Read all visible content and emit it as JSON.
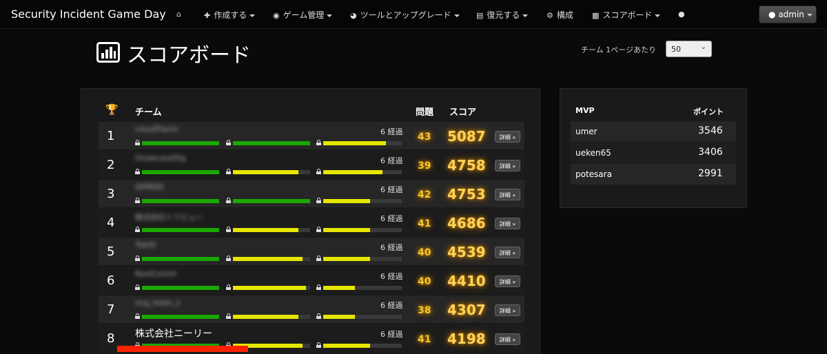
{
  "navbar": {
    "brand": "Security Incident Game Day",
    "items": [
      {
        "icon": "home-icon",
        "label": ""
      },
      {
        "icon": "plus-icon",
        "label": "作成する"
      },
      {
        "icon": "eye-icon",
        "label": "ゲーム管理"
      },
      {
        "icon": "dashboard-icon",
        "label": "ツールとアップグレード"
      },
      {
        "icon": "save-icon",
        "label": "復元する"
      },
      {
        "icon": "gear-icon",
        "label": "構成"
      },
      {
        "icon": "bar-chart-icon",
        "label": "スコアボード"
      },
      {
        "icon": "comment-icon",
        "label": ""
      }
    ],
    "user": "admin"
  },
  "page": {
    "title": "スコアボード",
    "per_page_label": "チーム 1ページあたり",
    "per_page_value": "50"
  },
  "scoreboard": {
    "headers": {
      "team": "チーム",
      "solved": "問題",
      "score": "スコア"
    },
    "rows": [
      {
        "rank": "1",
        "team": "cloudTrackr",
        "elapsed": "6 経過",
        "solved": "43",
        "score": "5087",
        "detail": "詳細 »",
        "bars": [
          {
            "color": "green",
            "fraction": 1.0
          },
          {
            "color": "green",
            "fraction": 1.0
          },
          {
            "color": "yellow",
            "fraction": 0.8
          }
        ]
      },
      {
        "rank": "2",
        "team": "ShowcaseDig",
        "elapsed": "6 経過",
        "solved": "39",
        "score": "4758",
        "detail": "詳細 »",
        "bars": [
          {
            "color": "green",
            "fraction": 1.0
          },
          {
            "color": "yellow",
            "fraction": 0.85
          },
          {
            "color": "yellow",
            "fraction": 0.75
          }
        ]
      },
      {
        "rank": "3",
        "team": "GPMDD",
        "elapsed": "6 経過",
        "solved": "42",
        "score": "4753",
        "detail": "詳細 »",
        "bars": [
          {
            "color": "green",
            "fraction": 1.0
          },
          {
            "color": "green",
            "fraction": 1.0
          },
          {
            "color": "yellow",
            "fraction": 0.6
          }
        ]
      },
      {
        "rank": "4",
        "team": "株式会社トリビュー",
        "elapsed": "6 経過",
        "solved": "41",
        "score": "4686",
        "detail": "詳細 »",
        "bars": [
          {
            "color": "green",
            "fraction": 1.0
          },
          {
            "color": "yellow",
            "fraction": 0.85
          },
          {
            "color": "yellow",
            "fraction": 0.6
          }
        ]
      },
      {
        "rank": "5",
        "team": "Tobiiii",
        "elapsed": "6 経過",
        "solved": "40",
        "score": "4539",
        "detail": "詳細 »",
        "bars": [
          {
            "color": "green",
            "fraction": 1.0
          },
          {
            "color": "yellow",
            "fraction": 0.9
          },
          {
            "color": "yellow",
            "fraction": 0.6
          }
        ]
      },
      {
        "rank": "6",
        "team": "RootComm",
        "elapsed": "6 経過",
        "solved": "40",
        "score": "4410",
        "detail": "詳細 »",
        "bars": [
          {
            "color": "green",
            "fraction": 1.0
          },
          {
            "color": "yellow",
            "fraction": 0.95
          },
          {
            "color": "yellow",
            "fraction": 0.4
          }
        ]
      },
      {
        "rank": "7",
        "team": "ncg_team_z",
        "elapsed": "6 経過",
        "solved": "38",
        "score": "4307",
        "detail": "詳細 »",
        "bars": [
          {
            "color": "green",
            "fraction": 1.0
          },
          {
            "color": "yellow",
            "fraction": 0.85
          },
          {
            "color": "yellow",
            "fraction": 0.4
          }
        ]
      },
      {
        "rank": "8",
        "team": "株式会社ニーリー",
        "elapsed": "6 経過",
        "solved": "41",
        "score": "4198",
        "detail": "詳細 »",
        "bars": [
          {
            "color": "green",
            "fraction": 1.0
          },
          {
            "color": "yellow",
            "fraction": 0.9
          },
          {
            "color": "yellow",
            "fraction": 0.6
          }
        ]
      }
    ]
  },
  "mvp": {
    "headers": {
      "name": "MVP",
      "points": "ポイント"
    },
    "rows": [
      {
        "name": "umer",
        "points": "3546"
      },
      {
        "name": "ueken65",
        "points": "3406"
      },
      {
        "name": "potesara",
        "points": "2991"
      }
    ]
  }
}
